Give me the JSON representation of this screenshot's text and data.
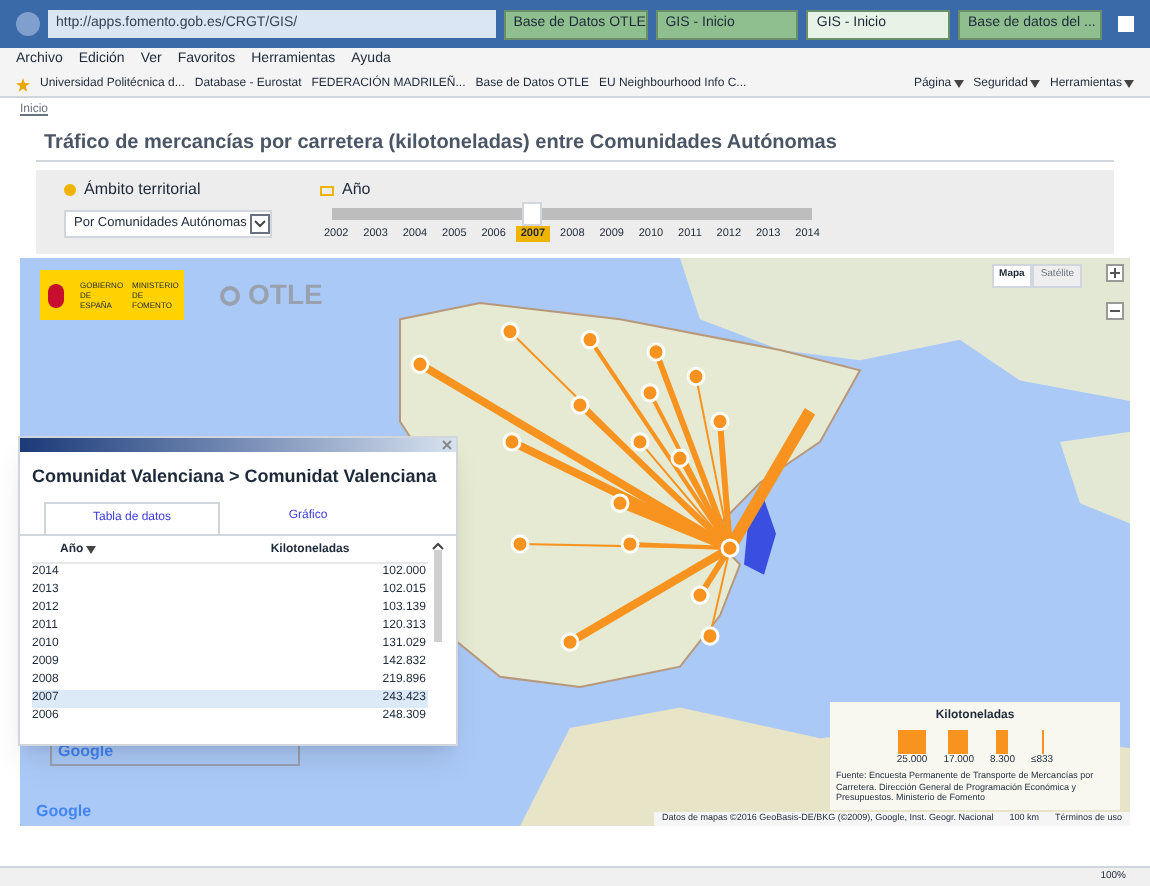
{
  "browser": {
    "address": "http://apps.fomento.gob.es/CRGT/GIS/",
    "tabs": [
      {
        "label": "Base de Datos OTLE",
        "selected": false
      },
      {
        "label": "GIS - Inicio",
        "selected": false
      },
      {
        "label": "GIS - Inicio",
        "selected": true
      },
      {
        "label": "Base de datos del ...",
        "selected": false
      }
    ],
    "menu": [
      "Archivo",
      "Edición",
      "Ver",
      "Favoritos",
      "Herramientas",
      "Ayuda"
    ],
    "favorites": [
      "Universidad Politécnica d...",
      "Database - Eurostat",
      "FEDERACIÓN MADRILEÑ...",
      "Base de Datos OTLE",
      "EU Neighbourhood Info C..."
    ],
    "tools": [
      "Página",
      "Seguridad",
      "Herramientas"
    ],
    "zoom": "100%"
  },
  "breadcrumb": "Inicio",
  "title": "Tráfico de mercancías por carretera (kilotoneladas) entre Comunidades Autónomas",
  "filters": {
    "territory_label": "Ámbito territorial",
    "territory_value": "Por Comunidades Autónomas",
    "year_label": "Año",
    "years": [
      {
        "label": "2002",
        "selected": false
      },
      {
        "label": "2003",
        "selected": false
      },
      {
        "label": "2004",
        "selected": false
      },
      {
        "label": "2005",
        "selected": false
      },
      {
        "label": "2006",
        "selected": false
      },
      {
        "label": "2007",
        "selected": true
      },
      {
        "label": "2008",
        "selected": false
      },
      {
        "label": "2009",
        "selected": false
      },
      {
        "label": "2010",
        "selected": false
      },
      {
        "label": "2011",
        "selected": false
      },
      {
        "label": "2012",
        "selected": false
      },
      {
        "label": "2013",
        "selected": false
      },
      {
        "label": "2014",
        "selected": false
      }
    ]
  },
  "map": {
    "logo_left": "GOBIERNO DE ESPAÑA",
    "logo_right": "MINISTERIO DE FOMENTO",
    "brand": "OTLE",
    "map_types": [
      {
        "label": "Mapa",
        "selected": true
      },
      {
        "label": "Satélite",
        "selected": false
      }
    ],
    "google": [
      "Google",
      "Google"
    ],
    "attribution": "Datos de mapas ©2016 GeoBasis-DE/BKG (©2009), Google, Inst. Geogr. Nacional",
    "scale": "100 km",
    "terms": "Términos de uso"
  },
  "popup": {
    "title": "Comunidat Valenciana > Comunidat Valenciana",
    "tabs": [
      {
        "label": "Tabla de datos",
        "selected": true
      },
      {
        "label": "Gráfico",
        "selected": false
      }
    ],
    "columns": [
      "Año",
      "Kilotoneladas"
    ],
    "rows": [
      {
        "year": "2014",
        "value": "102.000",
        "selected": false
      },
      {
        "year": "2013",
        "value": "102.015",
        "selected": false
      },
      {
        "year": "2012",
        "value": "103.139",
        "selected": false
      },
      {
        "year": "2011",
        "value": "120.313",
        "selected": false
      },
      {
        "year": "2010",
        "value": "131.029",
        "selected": false
      },
      {
        "year": "2009",
        "value": "142.832",
        "selected": false
      },
      {
        "year": "2008",
        "value": "219.896",
        "selected": false
      },
      {
        "year": "2007",
        "value": "243.423",
        "selected": true
      },
      {
        "year": "2006",
        "value": "248.309",
        "selected": false
      }
    ]
  },
  "legend": {
    "title": "Kilotoneladas",
    "items": [
      "25.000",
      "17.000",
      "8.300",
      "≤833"
    ],
    "source": "Fuente: Encuesta Permanente de Transporte de Mercancías por Carretera. Dirección General de Programación Económica y Presupuestos. Ministerio de Fomento"
  }
}
